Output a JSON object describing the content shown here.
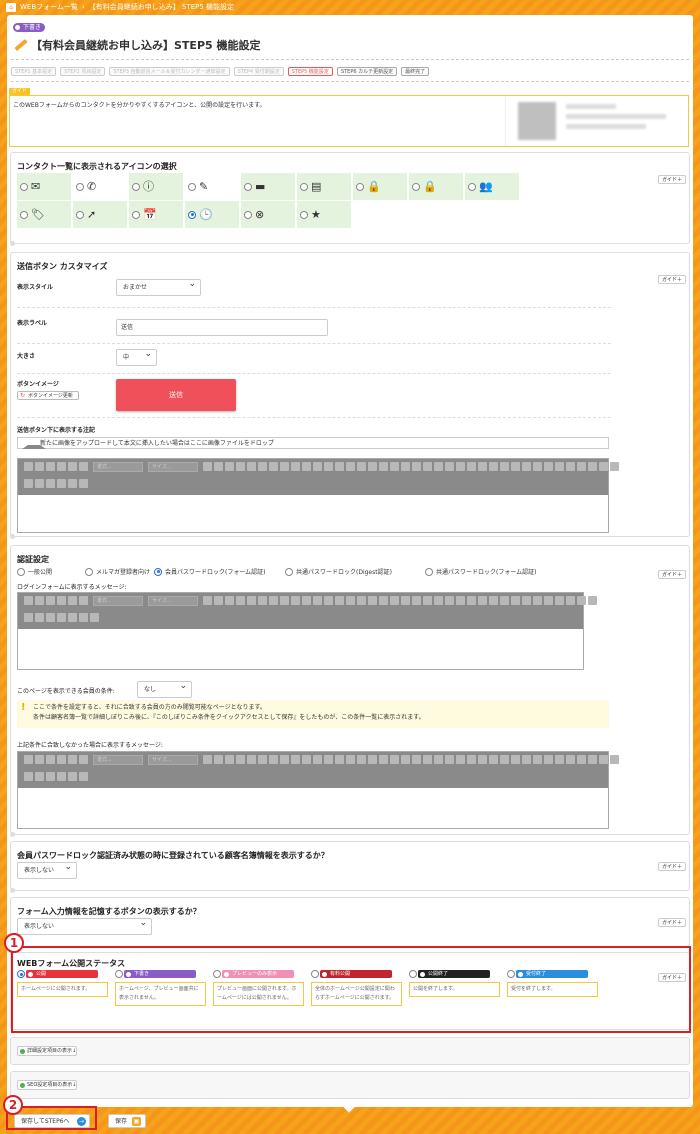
{
  "breadcrumb": {
    "items": [
      "WEBフォーム一覧",
      "【有料会員継続お申し込み】 STEP5 機能設定"
    ]
  },
  "page": {
    "badge": "下書き",
    "title": "【有料会員継続お申し込み】STEP5 機能設定"
  },
  "steps": [
    "STEP1 基本設定",
    "STEP2 項目設定",
    "STEP3 自動返信メール＆受付カレンダー通知設定",
    "STEP4 受付期設定",
    "STEP5 機能設定",
    "STEP6 カルテ更新設定",
    "最終完了"
  ],
  "guide": {
    "tag": "ガイド",
    "text": "このWEBフォームからのコンタクトを分かりやすくするアイコンと、公開の設定を行います。"
  },
  "guide_button_label": "ガイド＋",
  "icon_section": {
    "title": "コンタクト一覧に表示されるアイコンの選択",
    "icons": [
      "✉",
      "✆",
      "ⓘ",
      "✎",
      "▬",
      "▤",
      "🔒",
      "🔒",
      "👥",
      "🏷",
      "➚",
      "📅",
      "🕒",
      "⊗",
      "★"
    ],
    "selected_index": 12
  },
  "button_section": {
    "title": "送信ボタン カスタマイズ",
    "style_label": "表示スタイル",
    "style_value": "おまかせ",
    "label_label": "表示ラベル",
    "label_value": "送信",
    "size_label": "大きさ",
    "size_value": "中",
    "image_label": "ボタンイメージ",
    "image_update": "ボタンイメージ更新",
    "preview_label": "送信",
    "note_label": "送信ボタン下に表示する注記",
    "drop_text": "新たに画像をアップロードして本文に挿入したい場合はここに画像ファイルをドロップ",
    "font_select": "書式...",
    "size_select": "サイズ..."
  },
  "auth_section": {
    "title": "認証設定",
    "options": [
      "一般公開",
      "メルマガ登録者向け",
      "会員パスワードロック(フォーム認証)",
      "共通パスワードロック(Digest認証)",
      "共通パスワードロック(フォーム認証)"
    ],
    "selected_index": 2,
    "login_msg_label": "ログインフォームに表示するメッセージ:",
    "condition_label": "このページを表示できる会員の条件:",
    "condition_value": "なし",
    "notice_line1": "ここで条件を設定すると、それに合致する会員の方のみ閲覧可能なページとなります。",
    "notice_line2": "条件は顧客名簿一覧で詳細しぼりこみ後に、『このしぼりこみ条件をクイックアクセスとして保存』をしたものが、この条件一覧に表示されます。",
    "unmatched_msg_label": "上記条件に合致しなかった場合に表示するメッセージ:",
    "font_select": "書式...",
    "size_select": "サイズ..."
  },
  "member_section": {
    "title": "会員パスワードロック認証済み状態の時に登録されている顧客名簿情報を表示するか？",
    "value": "表示しない"
  },
  "remember_section": {
    "title": "フォーム入力情報を記憶するボタンの表示するか？",
    "value": "表示しない"
  },
  "status_section": {
    "title": "WEBフォーム公開ステータス",
    "selected_index": 0,
    "statuses": [
      {
        "label": "公開",
        "color": "#e8323c",
        "desc": "ホームページに公開されます。"
      },
      {
        "label": "下書き",
        "color": "#8a5cc7",
        "desc": "ホームページ、プレビュー画面共に表示されません。"
      },
      {
        "label": "プレビューのみ表示",
        "color": "#f28fb8",
        "desc": "プレビュー画面に公開されます。ホームページには公開されません。"
      },
      {
        "label": "有料公開",
        "color": "#c0242c",
        "desc": "全体のホームページ公開設定に関わらずホームページに公開されます。"
      },
      {
        "label": "公開終了",
        "color": "#222222",
        "desc": "公開を終了します。"
      },
      {
        "label": "受付終了",
        "color": "#2a8de0",
        "desc": "受付を終了します。"
      }
    ]
  },
  "expanders": [
    "詳細設定項目の表示↓",
    "SEO設定項目の表示↓"
  ],
  "footer": {
    "next_label": "保存してSTEP6へ",
    "save_label": "保存"
  },
  "annotations": [
    "1",
    "2"
  ]
}
